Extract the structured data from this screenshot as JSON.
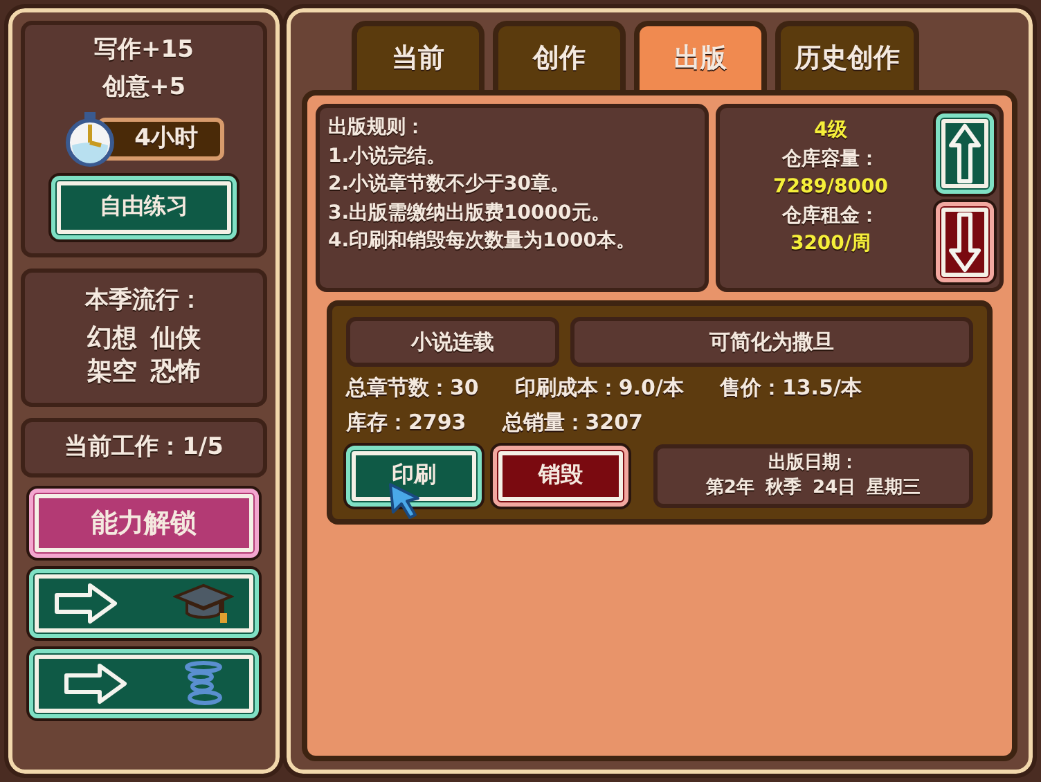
{
  "sidebar": {
    "stats": [
      "写作+15",
      "创意+5"
    ],
    "timer": "4小时",
    "practice_button": "自由练习",
    "trend": {
      "title": "本季流行：",
      "genres": [
        "幻想",
        "仙侠",
        "架空",
        "恐怖"
      ]
    },
    "current_work": "当前工作：1/5",
    "unlock_button": "能力解锁",
    "nav_buttons": [
      {
        "kind": "graduation"
      },
      {
        "kind": "spring"
      }
    ]
  },
  "tabs": [
    {
      "label": "当前",
      "selected": false
    },
    {
      "label": "创作",
      "selected": false
    },
    {
      "label": "出版",
      "selected": true
    },
    {
      "label": "历史创作",
      "selected": false
    }
  ],
  "rules": {
    "title": "出版规则：",
    "items": [
      "1.小说完结。",
      "2.小说章节数不少于30章。",
      "3.出版需缴纳出版费10000元。",
      "4.印刷和销毁每次数量为1000本。"
    ]
  },
  "warehouse": {
    "level": "4级",
    "capacity_label": "仓库容量：",
    "capacity": "7289/8000",
    "rent_label": "仓库租金：",
    "rent": "3200/周"
  },
  "book": {
    "title": "小说连载",
    "subtitle": "可简化为撒旦",
    "stat_lines": [
      [
        "总章节数：30",
        "印刷成本：9.0/本",
        "售价：13.5/本"
      ],
      [
        "库存：2793",
        "总销量：3207"
      ]
    ],
    "actions": [
      {
        "kind": "print",
        "label": "印刷"
      },
      {
        "kind": "destroy",
        "label": "销毁"
      }
    ],
    "publish_date": {
      "label": "出版日期：",
      "parts": [
        "第2年",
        "秋季",
        "24日",
        "星期三"
      ]
    }
  }
}
